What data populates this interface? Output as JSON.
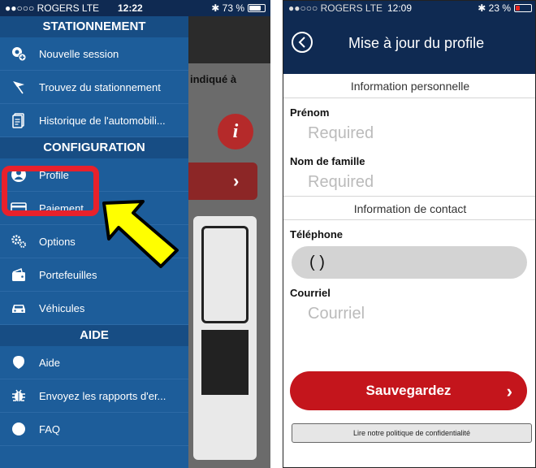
{
  "left_screen": {
    "status": {
      "carrier": "●●○○○ ROGERS LTE",
      "time": "12:22",
      "battery": "✱ 73 %"
    },
    "background": {
      "partial_text": "indiqué à",
      "info_icon_glyph": "i",
      "chevron": "›"
    },
    "drawer": {
      "sections": [
        {
          "title": "STATIONNEMENT",
          "items": [
            {
              "label": "Nouvelle session",
              "icon": "new-session-icon"
            },
            {
              "label": "Trouvez du stationnement",
              "icon": "flag-icon"
            },
            {
              "label": "Historique de l'automobili...",
              "icon": "history-icon"
            }
          ]
        },
        {
          "title": "CONFIGURATION",
          "items": [
            {
              "label": "Profile",
              "icon": "profile-icon"
            },
            {
              "label": "Paiement",
              "icon": "credit-card-icon"
            },
            {
              "label": "Options",
              "icon": "gears-icon"
            },
            {
              "label": "Portefeuilles",
              "icon": "wallet-icon"
            },
            {
              "label": "Véhicules",
              "icon": "car-icon"
            }
          ]
        },
        {
          "title": "AIDE",
          "items": [
            {
              "label": "Aide",
              "icon": "help-icon"
            },
            {
              "label": "Envoyez les rapports d'er...",
              "icon": "bug-icon"
            },
            {
              "label": "FAQ",
              "icon": "faq-icon"
            }
          ]
        }
      ]
    },
    "colors": {
      "drawer": "#1d5d9a",
      "section": "#174d84",
      "highlight": "#e8212b",
      "arrow": "#ffff00"
    }
  },
  "right_screen": {
    "status": {
      "carrier": "●●○○○ ROGERS LTE",
      "time": "12:09",
      "battery": "✱ 23 %"
    },
    "title": "Mise à jour du profile",
    "personal_section": "Information personnelle",
    "first_name_label": "Prénom",
    "first_name_placeholder": "Required",
    "last_name_label": "Nom de famille",
    "last_name_placeholder": "Required",
    "contact_section": "Information de contact",
    "phone_label": "Téléphone",
    "phone_value": "(     )",
    "email_label": "Courriel",
    "email_placeholder": "Courriel",
    "save_label": "Sauvegardez",
    "save_chevron": "›",
    "privacy_label": "Lire notre politique de confidentialité",
    "colors": {
      "navbar": "#0f2a52",
      "save": "#c4151c"
    }
  }
}
